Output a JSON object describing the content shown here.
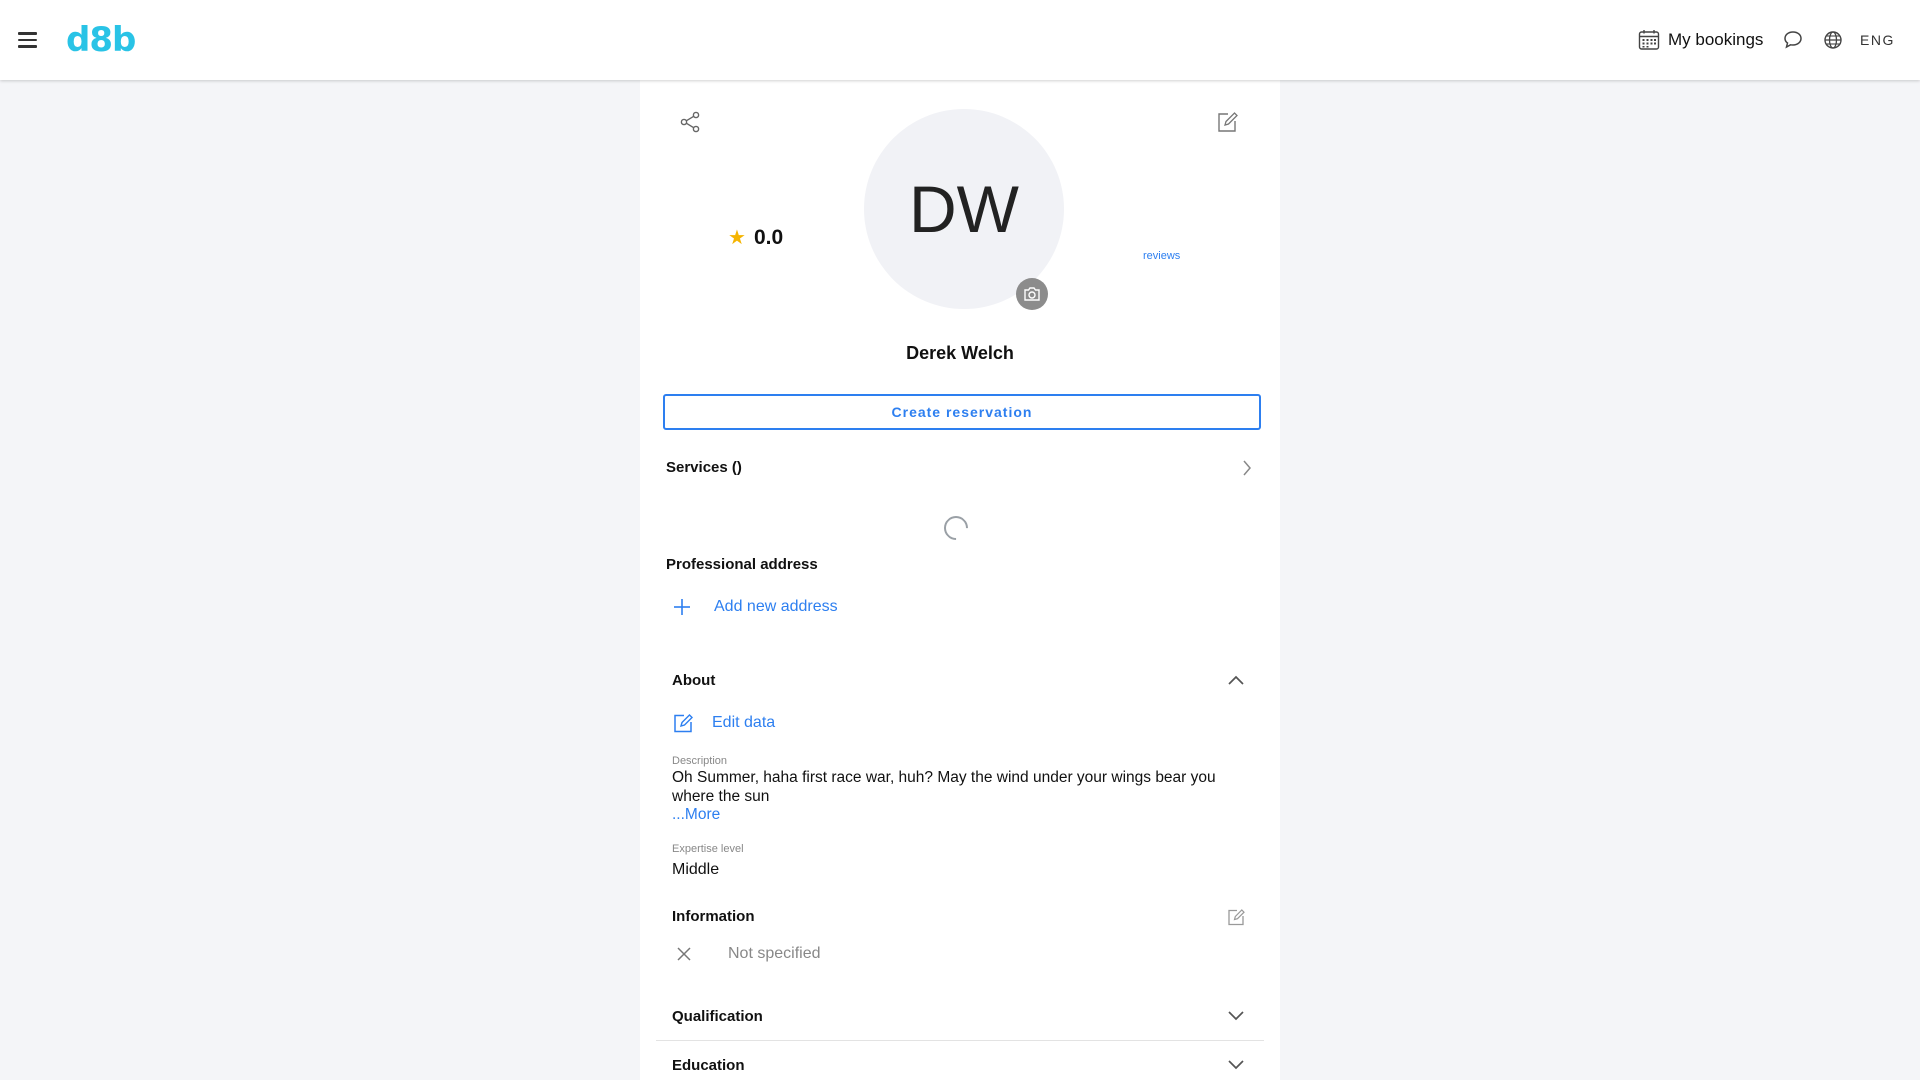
{
  "header": {
    "logo": "d8b",
    "bookings_label": "My bookings",
    "language": "ENG"
  },
  "profile": {
    "initials": "DW",
    "rating": "0.0",
    "reviews_label": "reviews",
    "name": "Derek Welch",
    "create_reservation_label": "Create reservation"
  },
  "services": {
    "title": "Services ()"
  },
  "address": {
    "title": "Professional address",
    "add_label": "Add new address"
  },
  "about": {
    "title": "About",
    "edit_label": "Edit data",
    "description_label": "Description",
    "description": "Oh Summer, haha first race war, huh? May the wind under your wings bear you where the sun",
    "more_label": "...More",
    "expertise_label": "Expertise level",
    "expertise_value": "Middle"
  },
  "information": {
    "title": "Information",
    "value": "Not specified"
  },
  "qualification": {
    "title": "Qualification"
  },
  "education": {
    "title": "Education"
  },
  "colors": {
    "accent": "#2d7ff0",
    "logo": "#29c3e6",
    "star": "#f5b400",
    "background": "#f4f5f8"
  }
}
